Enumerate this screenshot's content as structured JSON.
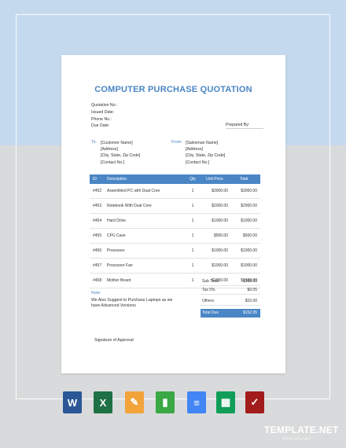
{
  "document": {
    "title": "COMPUTER PURCHASE QUOTATION",
    "meta": [
      "Quotation No.:",
      "Issued Date:",
      "Phone No.:",
      "Due Date:"
    ],
    "prepared_by": "Prepared By:",
    "to": {
      "label": "To:",
      "lines": [
        "[Customer Name]",
        "[Address]",
        "[City, State, Zip Code]",
        "[Contact No.]"
      ]
    },
    "from": {
      "label": "From:",
      "lines": [
        "[Salesman Name]",
        "[Address]",
        "[City, State, Zip Code]",
        "[Contact No.]"
      ]
    },
    "table": {
      "headers": [
        "ID",
        "Description",
        "Qty",
        "Unit Price",
        "Total"
      ],
      "rows": [
        {
          "id": "#452",
          "desc": "Assembled PC with Dual Core",
          "qty": "1",
          "unit": "$3000.00",
          "total": "$3000.00"
        },
        {
          "id": "#453",
          "desc": "Notebook With Dual Core",
          "qty": "1",
          "unit": "$2000.00",
          "total": "$2000.00"
        },
        {
          "id": "#454",
          "desc": "Hard Drive",
          "qty": "1",
          "unit": "$1000.00",
          "total": "$1000.00"
        },
        {
          "id": "#455",
          "desc": "CPU Case",
          "qty": "1",
          "unit": "$500.00",
          "total": "$500.00"
        },
        {
          "id": "#456",
          "desc": "Processor",
          "qty": "1",
          "unit": "$1000.00",
          "total": "$1000.00"
        },
        {
          "id": "#457",
          "desc": "Processor Fan",
          "qty": "1",
          "unit": "$1000.00",
          "total": "$1000.00"
        },
        {
          "id": "#458",
          "desc": "Mother Board",
          "qty": "1",
          "unit": "$1500.00",
          "total": "$1500.00"
        }
      ]
    },
    "summary": {
      "subtotal_label": "Sub Total",
      "subtotal": "$168.00",
      "tax_label": "Tax 5%",
      "tax": "$0.05",
      "others_label": "Others",
      "others": "$15.00",
      "due_label": "Total Due",
      "due": "$152.95"
    },
    "note_label": "Note:",
    "note_text": "We Also Suggest to Purchase Laptops as we have Advanced Versions",
    "signature": "Signature of Approval"
  },
  "apps": [
    {
      "name": "word-icon",
      "glyph": "W",
      "color": "#2b5797"
    },
    {
      "name": "excel-icon",
      "glyph": "X",
      "color": "#1e7145"
    },
    {
      "name": "pages-icon",
      "glyph": "✎",
      "color": "#f2a33a"
    },
    {
      "name": "numbers-icon",
      "glyph": "▮",
      "color": "#3aa845"
    },
    {
      "name": "google-docs-icon",
      "glyph": "≡",
      "color": "#4285f4"
    },
    {
      "name": "google-sheets-icon",
      "glyph": "▦",
      "color": "#0f9d58"
    },
    {
      "name": "pdf-icon",
      "glyph": "✓",
      "color": "#a31c1c"
    }
  ],
  "branding": {
    "logo": "TEMPLATE.NET",
    "sub": "TEMPLATE.NET"
  },
  "colors": {
    "accent": "#4a86c5",
    "bg_top": "#c5d9ee",
    "bg_bottom": "#d9dadb"
  }
}
